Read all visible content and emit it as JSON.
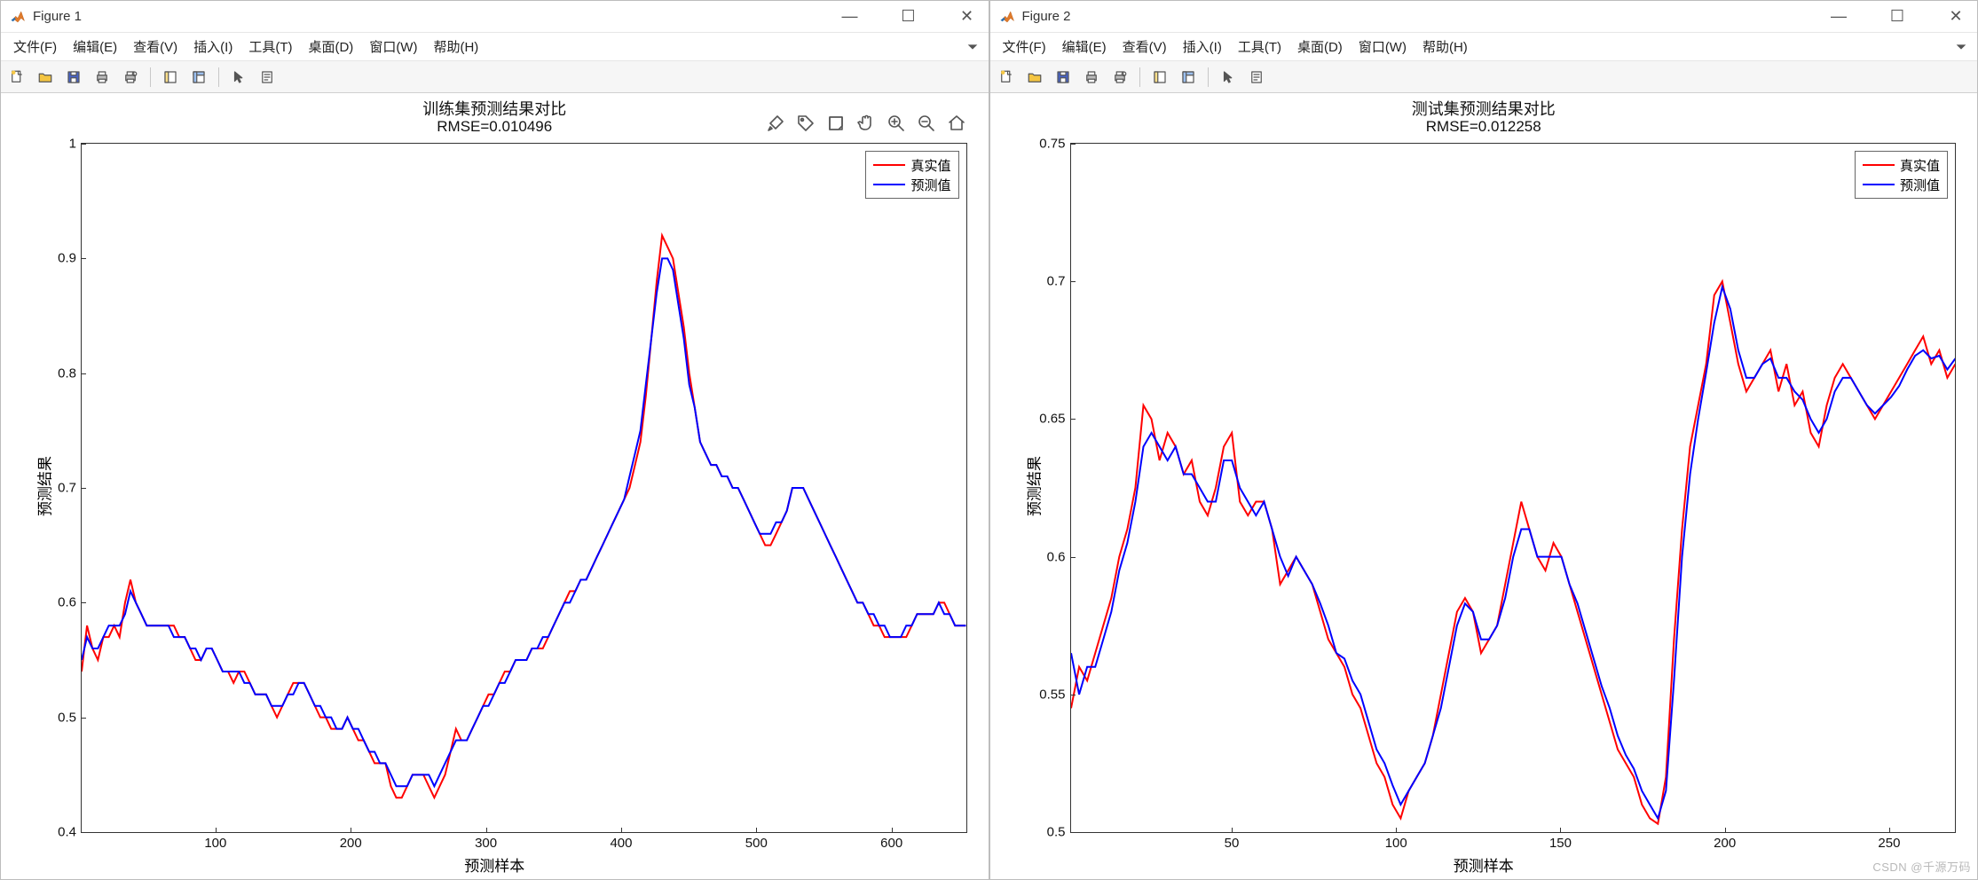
{
  "watermark": "CSDN @千源万码",
  "menus": {
    "file": "文件(F)",
    "edit": "编辑(E)",
    "view": "查看(V)",
    "insert": "插入(I)",
    "tools": "工具(T)",
    "desktop": "桌面(D)",
    "window": "窗口(W)",
    "help": "帮助(H)"
  },
  "win_minimize": "—",
  "win_maximize": "☐",
  "win_close": "✕",
  "legend": {
    "real": "真实值",
    "pred": "预测值"
  },
  "colors": {
    "real": "#ff0000",
    "pred": "#0000ff"
  },
  "chart_data": [
    {
      "window_title": "Figure 1",
      "type": "line",
      "title": "训练集预测结果对比",
      "subtitle": "RMSE=0.010496",
      "xlabel": "预测样本",
      "ylabel": "预测结果",
      "xlim": [
        1,
        655
      ],
      "ylim": [
        0.4,
        1.0
      ],
      "xticks": [
        100,
        200,
        300,
        400,
        500,
        600
      ],
      "yticks": [
        0.4,
        0.5,
        0.6,
        0.7,
        0.8,
        0.9,
        1.0
      ],
      "series": [
        {
          "name": "真实值",
          "color_key": "real",
          "values": [
            0.54,
            0.58,
            0.56,
            0.55,
            0.57,
            0.57,
            0.58,
            0.57,
            0.6,
            0.62,
            0.6,
            0.59,
            0.58,
            0.58,
            0.58,
            0.58,
            0.58,
            0.58,
            0.57,
            0.57,
            0.56,
            0.55,
            0.55,
            0.56,
            0.56,
            0.55,
            0.54,
            0.54,
            0.53,
            0.54,
            0.54,
            0.53,
            0.52,
            0.52,
            0.52,
            0.51,
            0.5,
            0.51,
            0.52,
            0.53,
            0.53,
            0.53,
            0.52,
            0.51,
            0.5,
            0.5,
            0.49,
            0.49,
            0.49,
            0.5,
            0.49,
            0.48,
            0.48,
            0.47,
            0.46,
            0.46,
            0.46,
            0.44,
            0.43,
            0.43,
            0.44,
            0.45,
            0.45,
            0.45,
            0.44,
            0.43,
            0.44,
            0.45,
            0.47,
            0.49,
            0.48,
            0.48,
            0.49,
            0.5,
            0.51,
            0.52,
            0.52,
            0.53,
            0.54,
            0.54,
            0.55,
            0.55,
            0.55,
            0.56,
            0.56,
            0.56,
            0.57,
            0.58,
            0.59,
            0.6,
            0.61,
            0.61,
            0.62,
            0.62,
            0.63,
            0.64,
            0.65,
            0.66,
            0.67,
            0.68,
            0.69,
            0.7,
            0.72,
            0.74,
            0.78,
            0.83,
            0.88,
            0.92,
            0.91,
            0.9,
            0.87,
            0.84,
            0.8,
            0.77,
            0.74,
            0.73,
            0.72,
            0.72,
            0.71,
            0.71,
            0.7,
            0.7,
            0.69,
            0.68,
            0.67,
            0.66,
            0.65,
            0.65,
            0.66,
            0.67,
            0.68,
            0.7,
            0.7,
            0.7,
            0.69,
            0.68,
            0.67,
            0.66,
            0.65,
            0.64,
            0.63,
            0.62,
            0.61,
            0.6,
            0.6,
            0.59,
            0.58,
            0.58,
            0.57,
            0.57,
            0.57,
            0.57,
            0.57,
            0.58,
            0.59,
            0.59,
            0.59,
            0.59,
            0.6,
            0.6,
            0.59,
            0.58,
            0.58,
            0.58
          ]
        },
        {
          "name": "预测值",
          "color_key": "pred",
          "values": [
            0.55,
            0.57,
            0.56,
            0.56,
            0.57,
            0.58,
            0.58,
            0.58,
            0.59,
            0.61,
            0.6,
            0.59,
            0.58,
            0.58,
            0.58,
            0.58,
            0.58,
            0.57,
            0.57,
            0.57,
            0.56,
            0.56,
            0.55,
            0.56,
            0.56,
            0.55,
            0.54,
            0.54,
            0.54,
            0.54,
            0.53,
            0.53,
            0.52,
            0.52,
            0.52,
            0.51,
            0.51,
            0.51,
            0.52,
            0.52,
            0.53,
            0.53,
            0.52,
            0.51,
            0.51,
            0.5,
            0.5,
            0.49,
            0.49,
            0.5,
            0.49,
            0.49,
            0.48,
            0.47,
            0.47,
            0.46,
            0.46,
            0.45,
            0.44,
            0.44,
            0.44,
            0.45,
            0.45,
            0.45,
            0.45,
            0.44,
            0.45,
            0.46,
            0.47,
            0.48,
            0.48,
            0.48,
            0.49,
            0.5,
            0.51,
            0.51,
            0.52,
            0.53,
            0.53,
            0.54,
            0.55,
            0.55,
            0.55,
            0.56,
            0.56,
            0.57,
            0.57,
            0.58,
            0.59,
            0.6,
            0.6,
            0.61,
            0.62,
            0.62,
            0.63,
            0.64,
            0.65,
            0.66,
            0.67,
            0.68,
            0.69,
            0.71,
            0.73,
            0.75,
            0.79,
            0.83,
            0.87,
            0.9,
            0.9,
            0.89,
            0.86,
            0.83,
            0.79,
            0.77,
            0.74,
            0.73,
            0.72,
            0.72,
            0.71,
            0.71,
            0.7,
            0.7,
            0.69,
            0.68,
            0.67,
            0.66,
            0.66,
            0.66,
            0.67,
            0.67,
            0.68,
            0.7,
            0.7,
            0.7,
            0.69,
            0.68,
            0.67,
            0.66,
            0.65,
            0.64,
            0.63,
            0.62,
            0.61,
            0.6,
            0.6,
            0.59,
            0.59,
            0.58,
            0.58,
            0.57,
            0.57,
            0.57,
            0.58,
            0.58,
            0.59,
            0.59,
            0.59,
            0.59,
            0.6,
            0.59,
            0.59,
            0.58,
            0.58,
            0.58
          ]
        }
      ]
    },
    {
      "window_title": "Figure 2",
      "type": "line",
      "title": "测试集预测结果对比",
      "subtitle": "RMSE=0.012258",
      "xlabel": "预测样本",
      "ylabel": "预测结果",
      "xlim": [
        1,
        270
      ],
      "ylim": [
        0.5,
        0.75
      ],
      "xticks": [
        50,
        100,
        150,
        200,
        250
      ],
      "yticks": [
        0.5,
        0.55,
        0.6,
        0.65,
        0.7,
        0.75
      ],
      "series": [
        {
          "name": "真实值",
          "color_key": "real",
          "values": [
            0.545,
            0.56,
            0.555,
            0.565,
            0.575,
            0.585,
            0.6,
            0.61,
            0.625,
            0.655,
            0.65,
            0.635,
            0.645,
            0.64,
            0.63,
            0.635,
            0.62,
            0.615,
            0.625,
            0.64,
            0.645,
            0.62,
            0.615,
            0.62,
            0.62,
            0.61,
            0.59,
            0.595,
            0.6,
            0.595,
            0.59,
            0.58,
            0.57,
            0.565,
            0.56,
            0.55,
            0.545,
            0.535,
            0.525,
            0.52,
            0.51,
            0.505,
            0.515,
            0.52,
            0.525,
            0.535,
            0.55,
            0.565,
            0.58,
            0.585,
            0.58,
            0.565,
            0.57,
            0.575,
            0.59,
            0.605,
            0.62,
            0.61,
            0.6,
            0.595,
            0.605,
            0.6,
            0.59,
            0.58,
            0.57,
            0.56,
            0.55,
            0.54,
            0.53,
            0.525,
            0.52,
            0.51,
            0.505,
            0.503,
            0.52,
            0.57,
            0.61,
            0.64,
            0.655,
            0.67,
            0.695,
            0.7,
            0.685,
            0.67,
            0.66,
            0.665,
            0.67,
            0.675,
            0.66,
            0.67,
            0.655,
            0.66,
            0.645,
            0.64,
            0.655,
            0.665,
            0.67,
            0.665,
            0.66,
            0.655,
            0.65,
            0.655,
            0.66,
            0.665,
            0.67,
            0.675,
            0.68,
            0.67,
            0.675,
            0.665,
            0.67
          ]
        },
        {
          "name": "预测值",
          "color_key": "pred",
          "values": [
            0.565,
            0.55,
            0.56,
            0.56,
            0.57,
            0.58,
            0.595,
            0.605,
            0.62,
            0.64,
            0.645,
            0.64,
            0.635,
            0.64,
            0.63,
            0.63,
            0.625,
            0.62,
            0.62,
            0.635,
            0.635,
            0.625,
            0.62,
            0.615,
            0.62,
            0.61,
            0.6,
            0.593,
            0.6,
            0.595,
            0.59,
            0.583,
            0.575,
            0.565,
            0.563,
            0.555,
            0.55,
            0.54,
            0.53,
            0.525,
            0.517,
            0.51,
            0.515,
            0.52,
            0.525,
            0.535,
            0.545,
            0.56,
            0.575,
            0.583,
            0.58,
            0.57,
            0.57,
            0.575,
            0.585,
            0.6,
            0.61,
            0.61,
            0.6,
            0.6,
            0.6,
            0.6,
            0.59,
            0.583,
            0.573,
            0.563,
            0.553,
            0.545,
            0.535,
            0.528,
            0.523,
            0.515,
            0.51,
            0.505,
            0.515,
            0.555,
            0.6,
            0.63,
            0.65,
            0.667,
            0.685,
            0.698,
            0.69,
            0.675,
            0.665,
            0.665,
            0.67,
            0.672,
            0.665,
            0.665,
            0.66,
            0.657,
            0.65,
            0.645,
            0.65,
            0.66,
            0.665,
            0.665,
            0.66,
            0.655,
            0.652,
            0.655,
            0.658,
            0.662,
            0.668,
            0.673,
            0.675,
            0.672,
            0.673,
            0.668,
            0.672
          ]
        }
      ]
    }
  ]
}
